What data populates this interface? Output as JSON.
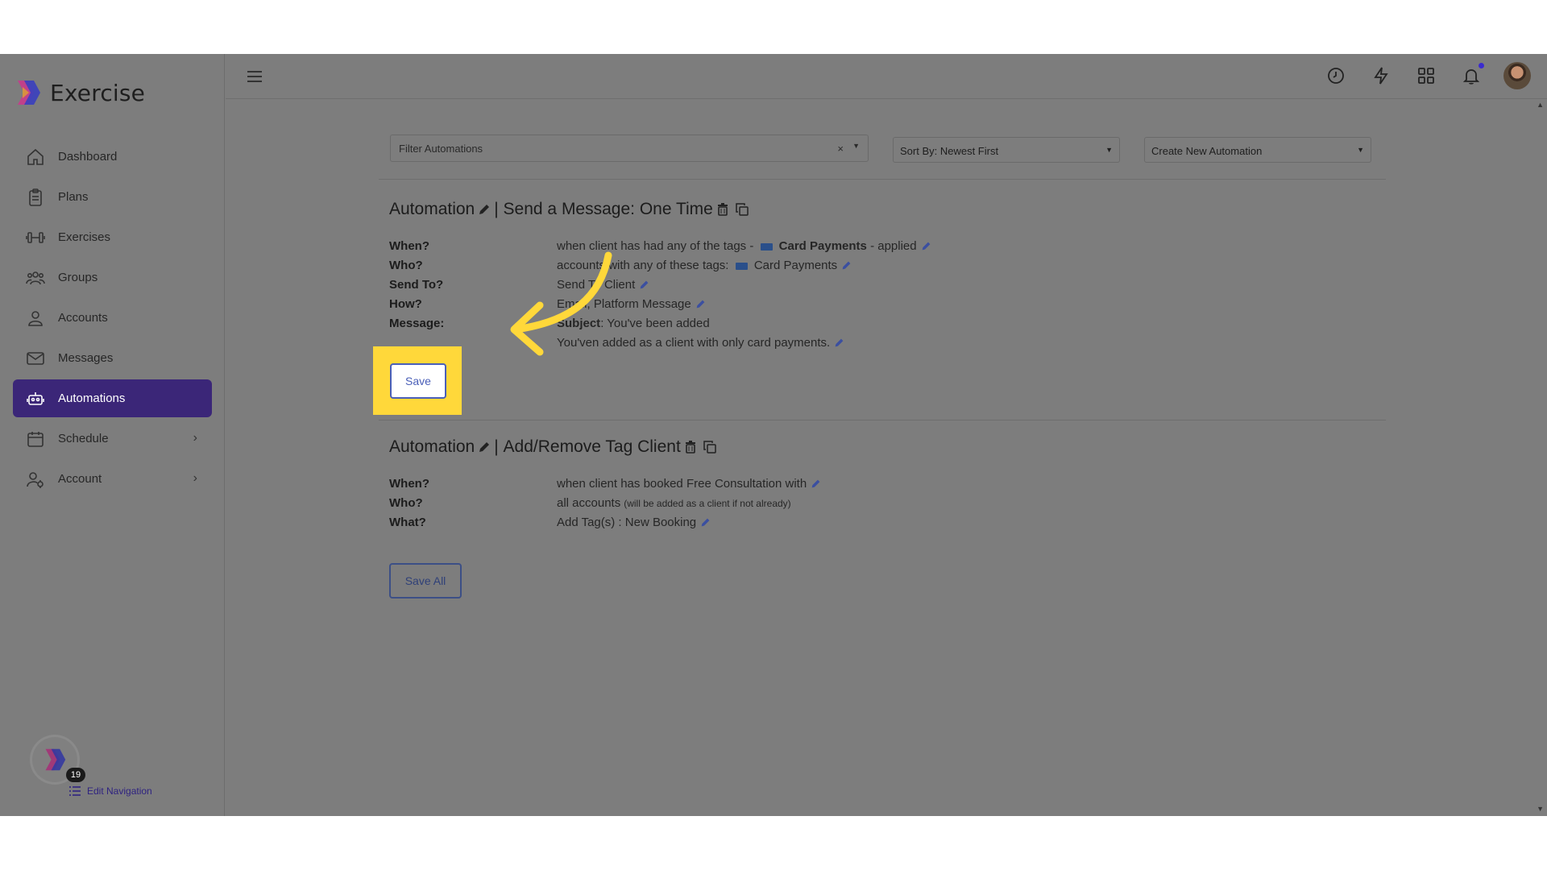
{
  "brand": {
    "name": "Exercise"
  },
  "sidebar": {
    "items": [
      {
        "label": "Dashboard",
        "icon": "home-icon"
      },
      {
        "label": "Plans",
        "icon": "clipboard-icon"
      },
      {
        "label": "Exercises",
        "icon": "dumbbell-icon"
      },
      {
        "label": "Groups",
        "icon": "users-icon"
      },
      {
        "label": "Accounts",
        "icon": "user-icon"
      },
      {
        "label": "Messages",
        "icon": "envelope-icon"
      },
      {
        "label": "Automations",
        "icon": "robot-icon",
        "active": true
      },
      {
        "label": "Schedule",
        "icon": "calendar-icon",
        "chevron": true
      },
      {
        "label": "Account",
        "icon": "user-settings-icon",
        "chevron": true
      }
    ],
    "badge_count": "19",
    "edit_navigation": "Edit Navigation"
  },
  "toolbar": {
    "filter_placeholder": "Filter Automations",
    "filter_clear": "×",
    "sort_label": "Sort By: Newest First",
    "create_label": "Create New Automation"
  },
  "automations": [
    {
      "title_prefix": "Automation",
      "title_sep": "|",
      "title_name": "Send a Message: One Time",
      "rows": {
        "when_label": "When?",
        "when_value_pre": "when client has had any of the tags -",
        "when_tag": "Card Payments",
        "when_value_post": "- applied",
        "who_label": "Who?",
        "who_value": "accounts with any of these tags:",
        "who_tag": "Card Payments",
        "send_label": "Send To?",
        "send_value": "Send To Client",
        "how_label": "How?",
        "how_value": "Email, Platform Message",
        "message_label": "Message:",
        "subject_label": "Subject",
        "subject_value": ": You've been added",
        "body": "You'ven added as a client with only card payments."
      },
      "save_label": "Save"
    },
    {
      "title_prefix": "Automation",
      "title_sep": "|",
      "title_name": "Add/Remove Tag Client",
      "rows": {
        "when_label": "When?",
        "when_value": "when client has booked Free Consultation with",
        "who_label": "Who?",
        "who_value": "all accounts",
        "who_note": "(will be added as a client if not already)",
        "what_label": "What?",
        "what_value": "Add Tag(s) : New Booking"
      }
    }
  ],
  "save_all_label": "Save All",
  "colors": {
    "accent": "#3b2678",
    "highlight": "#ffd83a",
    "button_border": "#4a5fb8"
  }
}
